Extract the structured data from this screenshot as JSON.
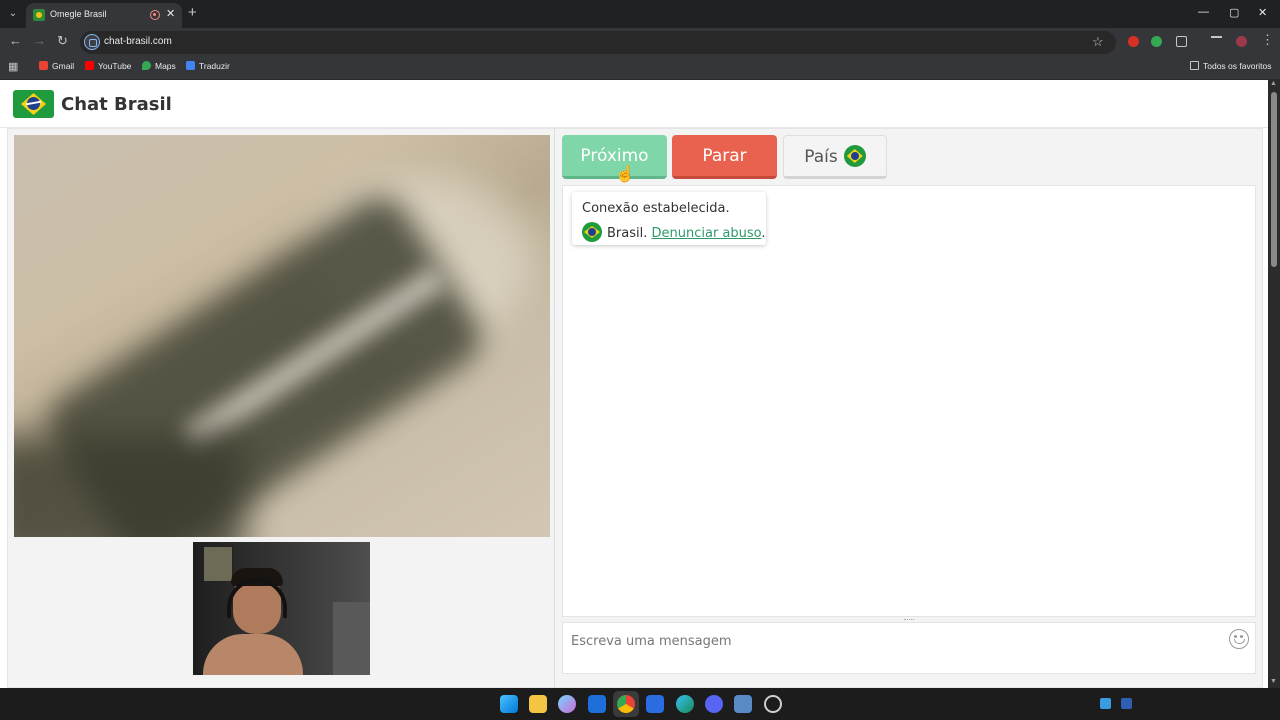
{
  "browser": {
    "tab_title": "Omegle Brasil",
    "tab_close": "✕",
    "new_tab": "+",
    "tab_list": "⌄",
    "window_controls": {
      "minimize": "—",
      "maximize": "▢",
      "close": "✕"
    },
    "nav": {
      "back": "←",
      "forward": "→",
      "reload": "↻"
    },
    "url": "chat-brasil.com",
    "bookmark_star": "☆",
    "menu": "⋮",
    "apps_icon": "▦",
    "bookmarks": [
      {
        "label": "Gmail",
        "color": "#ea4335"
      },
      {
        "label": "YouTube",
        "color": "#ff0000"
      },
      {
        "label": "Maps",
        "color": "#34a853"
      },
      {
        "label": "Traduzir",
        "color": "#4285f4"
      }
    ],
    "all_bookmarks": "Todos os favoritos"
  },
  "site": {
    "title": "Chat Brasil"
  },
  "controls": {
    "next_label": "Próximo",
    "stop_label": "Parar",
    "country_label": "País"
  },
  "chat": {
    "status_message": "Conexão estabelecida.",
    "country_name": "Brasil.",
    "report_link": "Denunciar abuso",
    "report_suffix": ".",
    "input_placeholder": "Escreva uma mensagem"
  },
  "colors": {
    "next_button": "#7fd6a8",
    "stop_button": "#e8624f",
    "link": "#2e9a6a",
    "flag_green": "#1f9a3d",
    "flag_yellow": "#f7d117",
    "flag_blue": "#1d3f8f"
  },
  "taskbar": {
    "icons": [
      "windows-start-icon",
      "file-explorer-icon",
      "copilot-icon",
      "mail-icon",
      "chrome-icon",
      "store-icon",
      "edge-icon",
      "discord-icon",
      "app-icon",
      "obs-icon"
    ]
  }
}
